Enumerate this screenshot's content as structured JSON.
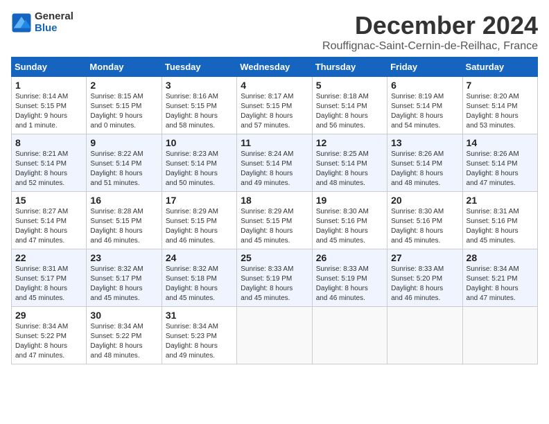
{
  "logo": {
    "general": "General",
    "blue": "Blue"
  },
  "header": {
    "month": "December 2024",
    "location": "Rouffignac-Saint-Cernin-de-Reilhac, France"
  },
  "weekdays": [
    "Sunday",
    "Monday",
    "Tuesday",
    "Wednesday",
    "Thursday",
    "Friday",
    "Saturday"
  ],
  "weeks": [
    [
      {
        "day": 1,
        "info": "Sunrise: 8:14 AM\nSunset: 5:15 PM\nDaylight: 9 hours\nand 1 minute."
      },
      {
        "day": 2,
        "info": "Sunrise: 8:15 AM\nSunset: 5:15 PM\nDaylight: 9 hours\nand 0 minutes."
      },
      {
        "day": 3,
        "info": "Sunrise: 8:16 AM\nSunset: 5:15 PM\nDaylight: 8 hours\nand 58 minutes."
      },
      {
        "day": 4,
        "info": "Sunrise: 8:17 AM\nSunset: 5:15 PM\nDaylight: 8 hours\nand 57 minutes."
      },
      {
        "day": 5,
        "info": "Sunrise: 8:18 AM\nSunset: 5:14 PM\nDaylight: 8 hours\nand 56 minutes."
      },
      {
        "day": 6,
        "info": "Sunrise: 8:19 AM\nSunset: 5:14 PM\nDaylight: 8 hours\nand 54 minutes."
      },
      {
        "day": 7,
        "info": "Sunrise: 8:20 AM\nSunset: 5:14 PM\nDaylight: 8 hours\nand 53 minutes."
      }
    ],
    [
      {
        "day": 8,
        "info": "Sunrise: 8:21 AM\nSunset: 5:14 PM\nDaylight: 8 hours\nand 52 minutes."
      },
      {
        "day": 9,
        "info": "Sunrise: 8:22 AM\nSunset: 5:14 PM\nDaylight: 8 hours\nand 51 minutes."
      },
      {
        "day": 10,
        "info": "Sunrise: 8:23 AM\nSunset: 5:14 PM\nDaylight: 8 hours\nand 50 minutes."
      },
      {
        "day": 11,
        "info": "Sunrise: 8:24 AM\nSunset: 5:14 PM\nDaylight: 8 hours\nand 49 minutes."
      },
      {
        "day": 12,
        "info": "Sunrise: 8:25 AM\nSunset: 5:14 PM\nDaylight: 8 hours\nand 48 minutes."
      },
      {
        "day": 13,
        "info": "Sunrise: 8:26 AM\nSunset: 5:14 PM\nDaylight: 8 hours\nand 48 minutes."
      },
      {
        "day": 14,
        "info": "Sunrise: 8:26 AM\nSunset: 5:14 PM\nDaylight: 8 hours\nand 47 minutes."
      }
    ],
    [
      {
        "day": 15,
        "info": "Sunrise: 8:27 AM\nSunset: 5:14 PM\nDaylight: 8 hours\nand 47 minutes."
      },
      {
        "day": 16,
        "info": "Sunrise: 8:28 AM\nSunset: 5:15 PM\nDaylight: 8 hours\nand 46 minutes."
      },
      {
        "day": 17,
        "info": "Sunrise: 8:29 AM\nSunset: 5:15 PM\nDaylight: 8 hours\nand 46 minutes."
      },
      {
        "day": 18,
        "info": "Sunrise: 8:29 AM\nSunset: 5:15 PM\nDaylight: 8 hours\nand 45 minutes."
      },
      {
        "day": 19,
        "info": "Sunrise: 8:30 AM\nSunset: 5:16 PM\nDaylight: 8 hours\nand 45 minutes."
      },
      {
        "day": 20,
        "info": "Sunrise: 8:30 AM\nSunset: 5:16 PM\nDaylight: 8 hours\nand 45 minutes."
      },
      {
        "day": 21,
        "info": "Sunrise: 8:31 AM\nSunset: 5:16 PM\nDaylight: 8 hours\nand 45 minutes."
      }
    ],
    [
      {
        "day": 22,
        "info": "Sunrise: 8:31 AM\nSunset: 5:17 PM\nDaylight: 8 hours\nand 45 minutes."
      },
      {
        "day": 23,
        "info": "Sunrise: 8:32 AM\nSunset: 5:17 PM\nDaylight: 8 hours\nand 45 minutes."
      },
      {
        "day": 24,
        "info": "Sunrise: 8:32 AM\nSunset: 5:18 PM\nDaylight: 8 hours\nand 45 minutes."
      },
      {
        "day": 25,
        "info": "Sunrise: 8:33 AM\nSunset: 5:19 PM\nDaylight: 8 hours\nand 45 minutes."
      },
      {
        "day": 26,
        "info": "Sunrise: 8:33 AM\nSunset: 5:19 PM\nDaylight: 8 hours\nand 46 minutes."
      },
      {
        "day": 27,
        "info": "Sunrise: 8:33 AM\nSunset: 5:20 PM\nDaylight: 8 hours\nand 46 minutes."
      },
      {
        "day": 28,
        "info": "Sunrise: 8:34 AM\nSunset: 5:21 PM\nDaylight: 8 hours\nand 47 minutes."
      }
    ],
    [
      {
        "day": 29,
        "info": "Sunrise: 8:34 AM\nSunset: 5:22 PM\nDaylight: 8 hours\nand 47 minutes."
      },
      {
        "day": 30,
        "info": "Sunrise: 8:34 AM\nSunset: 5:22 PM\nDaylight: 8 hours\nand 48 minutes."
      },
      {
        "day": 31,
        "info": "Sunrise: 8:34 AM\nSunset: 5:23 PM\nDaylight: 8 hours\nand 49 minutes."
      },
      null,
      null,
      null,
      null
    ]
  ]
}
